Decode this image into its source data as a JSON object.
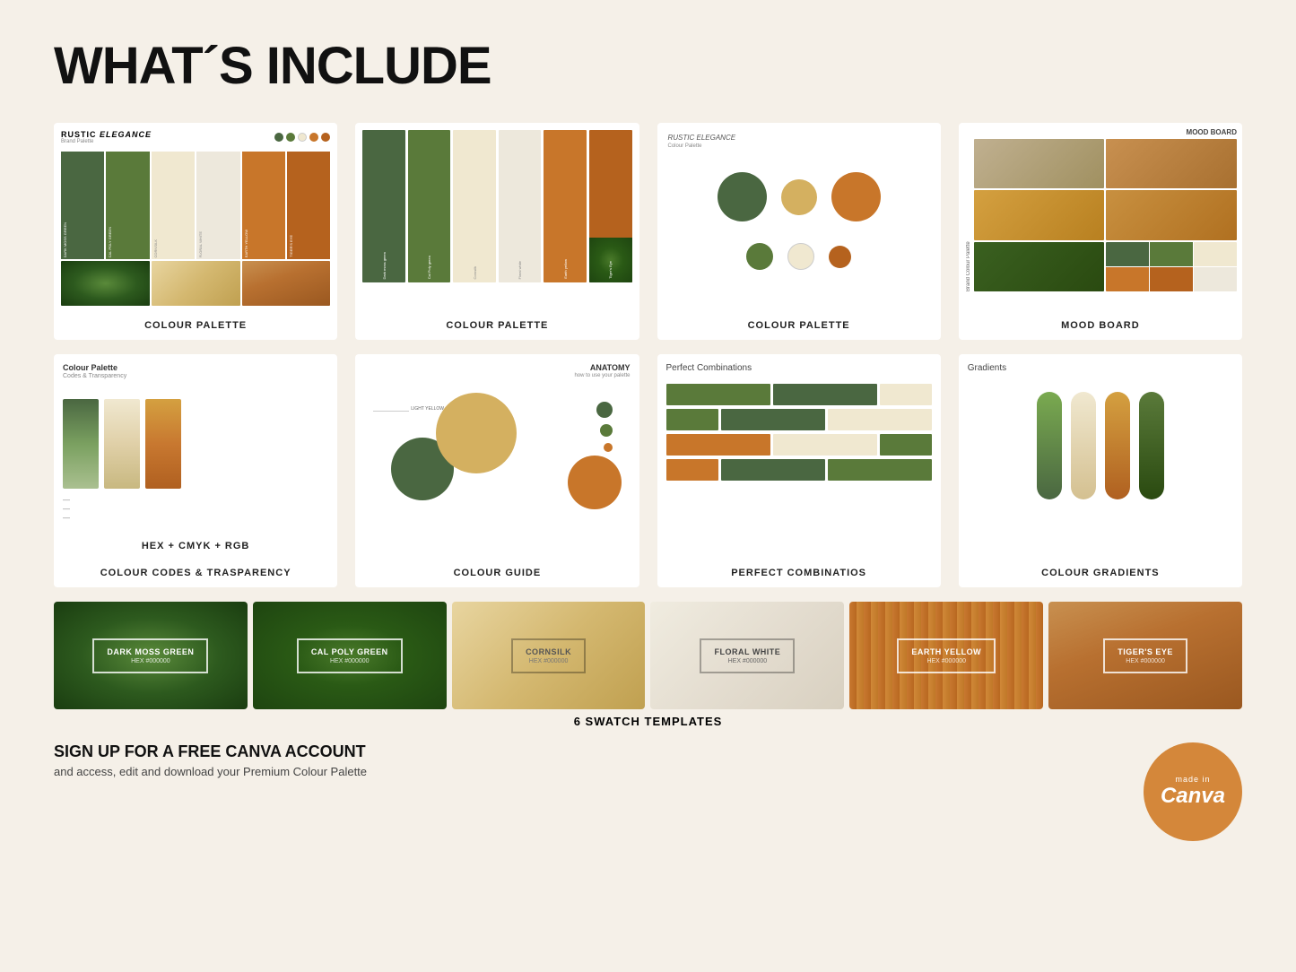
{
  "page": {
    "title": "WHAT´S INCLUDE",
    "background_color": "#f5f0e8"
  },
  "section1": {
    "cards": [
      {
        "id": "palette1",
        "label": "COLOUR PALETTE",
        "header_title_main": "RUSTIC",
        "header_title_italic": "ELEGANCE",
        "header_subtitle": "Brand Palette",
        "swatches": [
          {
            "name": "DARK MOSS GREEN",
            "color": "#4a6741",
            "bottom_color": "#3d8a3a"
          },
          {
            "name": "CAL POLY GREEN",
            "color": "#4a7a3a",
            "bottom_color": "#8ab870"
          },
          {
            "name": "CORNSILK",
            "color": "#f0e8d0",
            "bottom_color": "#e8d0a0"
          },
          {
            "name": "FLORAL WHITE",
            "color": "#ede8dc",
            "bottom_color": "#c8d0b0"
          },
          {
            "name": "EARTH YELLOW",
            "color": "#c8762a",
            "bottom_color": "#d4b060"
          },
          {
            "name": "TIGER'S EYE",
            "color": "#b5621e",
            "bottom_color": "#c87030"
          }
        ]
      },
      {
        "id": "palette2",
        "label": "COLOUR PALETTE",
        "swatches": [
          {
            "name": "Dark moss green",
            "color": "#4a6741"
          },
          {
            "name": "Cal Poly green",
            "color": "#5a7a3a"
          },
          {
            "name": "Cornsilk",
            "color": "#f0e8d0"
          },
          {
            "name": "Floral white",
            "color": "#ede8dc"
          },
          {
            "name": "Earth yellow",
            "color": "#c8762a"
          },
          {
            "name": "Tiger's Eye",
            "color": "#b5621e"
          }
        ]
      },
      {
        "id": "palette3",
        "label": "COLOUR PALETTE",
        "brand_title": "RUSTIC",
        "brand_italic": "ELEGANCE",
        "sub": "Colour Palette",
        "circles": [
          {
            "color": "#4a6741",
            "size": "large"
          },
          {
            "color": "#d4b060",
            "size": "medium"
          },
          {
            "color": "#c8762a",
            "size": "large"
          }
        ]
      },
      {
        "id": "moodboard",
        "label": "MOOD BOARD",
        "top_label": "MOOD BOARD",
        "side_label": "Brand Colour Palette"
      }
    ]
  },
  "section2": {
    "cards": [
      {
        "id": "colorcodes",
        "label": "COLOUR CODES & TRASPARENCY",
        "title": "Colour Palette",
        "subtitle": "Codes & Transparency"
      },
      {
        "id": "guide",
        "label": "COLOUR GUIDE",
        "title": "ANATOMY",
        "subtitle": "how to use your palette"
      },
      {
        "id": "perfectcomb",
        "label": "PERFECT COMBINATIOS",
        "title": "Perfect Combinations"
      },
      {
        "id": "gradients",
        "label": "COLOUR GRADIENTS",
        "title": "Gradients"
      }
    ]
  },
  "swatches": {
    "section_label": "6 SWATCH TEMPLATES",
    "items": [
      {
        "name": "DARK MOSS GREEN",
        "hex": "HEX #000000",
        "bg_class": "nature-green"
      },
      {
        "name": "CAL POLY GREEN",
        "hex": "HEX #000000",
        "bg_class": "nature-leaf"
      },
      {
        "name": "CORNSILK",
        "hex": "HEX #000000",
        "bg_class": "nature-sand-light"
      },
      {
        "name": "FLORAL WHITE",
        "hex": "HEX #000000",
        "bg_class": "nature-white-fabric"
      },
      {
        "name": "EARTH YELLOW",
        "hex": "HEX #000000",
        "bg_class": "nature-wood"
      },
      {
        "name": "TIGER'S EYE",
        "hex": "HEX #000000",
        "bg_class": "nature-desert"
      }
    ]
  },
  "footer": {
    "cta_title": "SIGN UP FOR A FREE CANVA ACCOUNT",
    "cta_sub": "and access, edit and download your Premium Colour Palette",
    "badge_line1": "made in",
    "badge_line2": "Canva"
  }
}
